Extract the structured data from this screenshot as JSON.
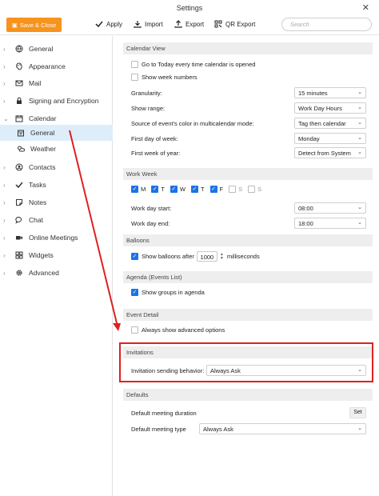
{
  "window": {
    "title": "Settings"
  },
  "toolbar": {
    "save_close": "Save & Close",
    "apply": "Apply",
    "import": "Import",
    "export": "Export",
    "qr_export": "QR Export",
    "search_placeholder": "Search"
  },
  "sidebar": {
    "items": [
      {
        "label": "General",
        "icon": "globe-icon"
      },
      {
        "label": "Appearance",
        "icon": "palette-icon"
      },
      {
        "label": "Mail",
        "icon": "mail-icon"
      },
      {
        "label": "Signing and Encryption",
        "icon": "lock-icon"
      },
      {
        "label": "Calendar",
        "icon": "calendar-icon"
      },
      {
        "label": "General",
        "icon": "calendar-general-icon"
      },
      {
        "label": "Weather",
        "icon": "weather-icon"
      },
      {
        "label": "Contacts",
        "icon": "contacts-icon"
      },
      {
        "label": "Tasks",
        "icon": "check-icon"
      },
      {
        "label": "Notes",
        "icon": "notes-icon"
      },
      {
        "label": "Chat",
        "icon": "chat-icon"
      },
      {
        "label": "Online Meetings",
        "icon": "video-icon"
      },
      {
        "label": "Widgets",
        "icon": "widgets-icon"
      },
      {
        "label": "Advanced",
        "icon": "gear-icon"
      }
    ]
  },
  "calendar_view": {
    "header": "Calendar View",
    "go_today": "Go to Today every time calendar is opened",
    "show_week_numbers": "Show week numbers",
    "granularity_label": "Granularity:",
    "granularity_value": "15 minutes",
    "show_range_label": "Show range:",
    "show_range_value": "Work Day Hours",
    "color_source_label": "Source of event's color in multicalendar mode:",
    "color_source_value": "Tag then calendar",
    "first_day_label": "First day of week:",
    "first_day_value": "Monday",
    "first_week_label": "First week of year:",
    "first_week_value": "Detect from System"
  },
  "work_week": {
    "header": "Work Week",
    "days": [
      {
        "label": "M",
        "checked": true
      },
      {
        "label": "T",
        "checked": true
      },
      {
        "label": "W",
        "checked": true
      },
      {
        "label": "T",
        "checked": true
      },
      {
        "label": "F",
        "checked": true
      },
      {
        "label": "S",
        "checked": false
      },
      {
        "label": "S",
        "checked": false
      }
    ],
    "start_label": "Work day start:",
    "start_value": "08:00",
    "end_label": "Work day end:",
    "end_value": "18:00"
  },
  "balloons": {
    "header": "Balloons",
    "show_after": "Show balloons after",
    "ms_value": "1000",
    "ms_unit": "milliseconds"
  },
  "agenda": {
    "header": "Agenda (Events List)",
    "show_groups": "Show groups in agenda"
  },
  "event_detail": {
    "header": "Event Detail",
    "always_advanced": "Always show advanced options"
  },
  "invitations": {
    "header": "Invitations",
    "behavior_label": "Invitation sending behavior:",
    "behavior_value": "Always Ask"
  },
  "defaults": {
    "header": "Defaults",
    "duration_label": "Default meeting duration",
    "set_button": "Set",
    "type_label": "Default meeting type",
    "type_value": "Always Ask"
  },
  "colors": {
    "accent": "#f7931e",
    "selection": "#ddeefa",
    "checkbox": "#1a73e8",
    "annotation": "#e02020"
  }
}
